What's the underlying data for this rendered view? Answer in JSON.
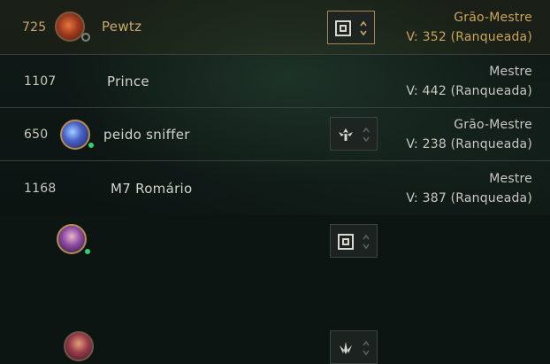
{
  "players": [
    {
      "level": "725",
      "name": "Pewtz",
      "tier": "Grão-Mestre",
      "victories": "V: 352 (Ranqueada)",
      "emblem": "grandmaster-emblem-icon",
      "status": "offline"
    },
    {
      "level": "1107",
      "name": "Prince",
      "tier": "Mestre",
      "victories": "V: 442 (Ranqueada)",
      "emblem": "master-emblem-icon",
      "status": "online"
    },
    {
      "level": "650",
      "name": "peido sniffer",
      "tier": "Grão-Mestre",
      "victories": "V: 238 (Ranqueada)",
      "emblem": "grandmaster-emblem-icon",
      "status": "online"
    },
    {
      "level": "1168",
      "name": "M7 Romário",
      "tier": "Mestre",
      "victories": "V: 387 (Ranqueada)",
      "emblem": "master-emblem-icon",
      "status": "none"
    }
  ],
  "colors": {
    "highlight_gold": "#c9a55a",
    "text": "#c8c8c0",
    "online": "#2fd470",
    "row_divider": "#3a3f3c"
  }
}
